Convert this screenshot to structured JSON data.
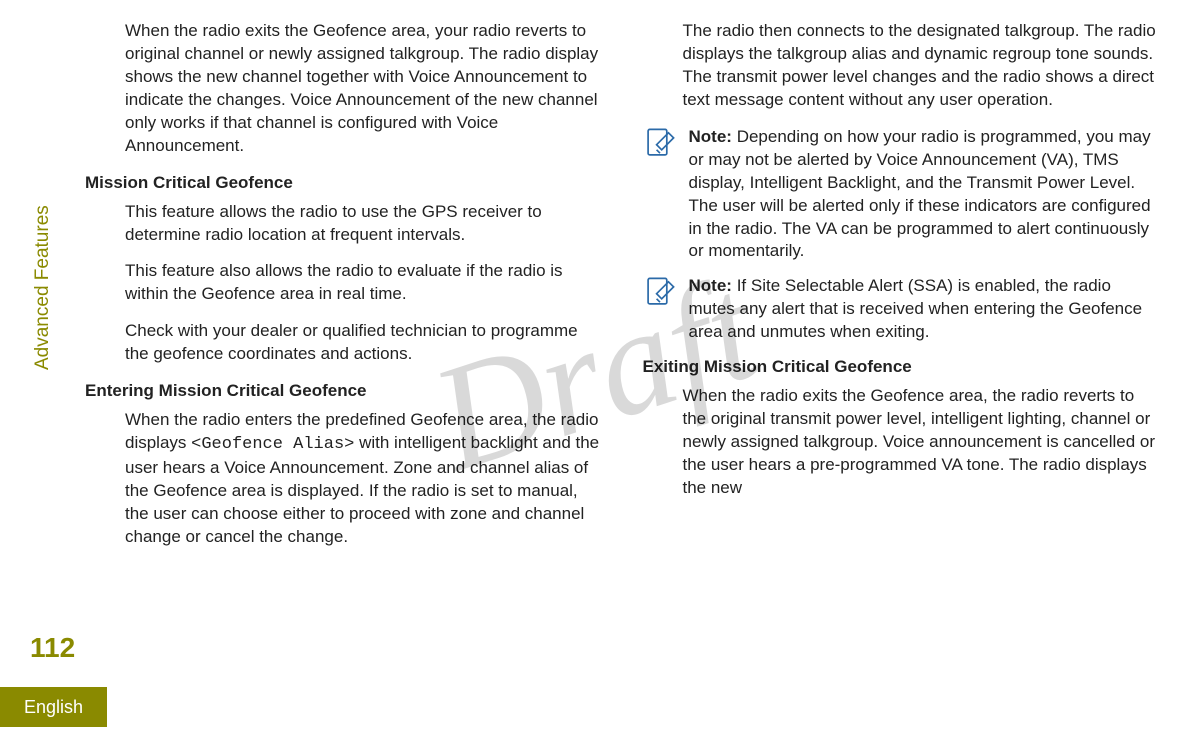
{
  "sidebar": {
    "section_label": "Advanced Features",
    "page_number": "112",
    "language": "English"
  },
  "watermark": "Draft",
  "left": {
    "p1": "When the radio exits the Geofence area, your radio reverts to original channel or newly assigned talkgroup. The radio display shows the new channel together with Voice Announcement to indicate the changes. Voice Announcement of the new channel only works if that channel is configured with Voice Announcement.",
    "h1": "Mission Critical Geofence",
    "p2": "This feature allows the radio to use the GPS receiver to determine radio location at frequent intervals.",
    "p3": "This feature also allows the radio to evaluate if the radio is within the Geofence area in real time.",
    "p4": "Check with your dealer or qualified technician to programme the geofence coordinates and actions.",
    "h2": "Entering Mission Critical Geofence",
    "p5a": "When the radio enters the predefined Geofence area, the radio displays ",
    "p5code": "<Geofence Alias>",
    "p5b": " with intelligent backlight and the user hears a Voice Announcement. Zone and channel alias of the Geofence area is displayed. If the radio is set to manual, the user can choose either to proceed with zone and channel change or cancel the change."
  },
  "right": {
    "p1": "The radio then connects to the designated talkgroup. The radio displays the talkgroup alias and dynamic regroup tone sounds. The transmit power level changes and the radio shows a direct text message content without any user operation.",
    "note1_title": "Note:",
    "note1_body": "Depending on how your radio is programmed, you may or may not be alerted by Voice Announcement (VA), TMS display, Intelligent Backlight, and the Transmit Power Level. The user will be alerted only if these indicators are configured in the radio. The VA can be programmed to alert continuously or momentarily.",
    "note2_title": "Note:",
    "note2_body": "If Site Selectable Alert (SSA) is enabled, the radio mutes any alert that is received when entering the Geofence area and unmutes when exiting.",
    "h1": "Exiting Mission Critical Geofence",
    "p2": "When the radio exits the Geofence area, the radio reverts to the original transmit power level, intelligent lighting, channel or newly assigned talkgroup. Voice announcement is cancelled or the user hears a pre-programmed VA tone. The radio displays the new"
  }
}
